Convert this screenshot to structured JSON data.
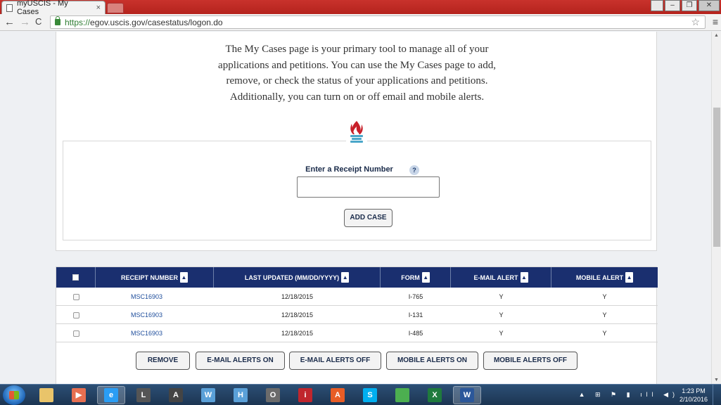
{
  "browser": {
    "tab_title": "myUSCIS - My Cases",
    "tab_close": "×",
    "url_scheme": "https://",
    "url_rest": "egov.uscis.gov/casestatus/logon.do",
    "back_glyph": "←",
    "forward_glyph": "→",
    "reload_glyph": "C",
    "star_glyph": "☆",
    "menu_glyph": "≡",
    "window_buttons": {
      "minimize": "–",
      "restore": "❐",
      "close": "✕"
    }
  },
  "intro": {
    "line1": "The My Cases page is your primary tool to manage all of your",
    "line2": "applications and petitions. You can use the My Cases page to add,",
    "line3": "remove, or check the status of your applications and petitions.",
    "line4": "Additionally, you can turn on or off email and mobile alerts."
  },
  "add_case_form": {
    "label": "Enter a Receipt Number",
    "help": "?",
    "input_value": "",
    "button": "ADD CASE"
  },
  "table": {
    "headers": {
      "receipt": "RECEIPT NUMBER",
      "updated": "LAST UPDATED (MM/DD/YYYY)",
      "form": "FORM",
      "email": "E-MAIL ALERT",
      "mobile": "MOBILE ALERT"
    },
    "rows": [
      {
        "receipt": "MSC16903",
        "updated": "12/18/2015",
        "form": "I-765",
        "email": "Y",
        "mobile": "Y"
      },
      {
        "receipt": "MSC16903",
        "updated": "12/18/2015",
        "form": "I-131",
        "email": "Y",
        "mobile": "Y"
      },
      {
        "receipt": "MSC16903",
        "updated": "12/18/2015",
        "form": "I-485",
        "email": "Y",
        "mobile": "Y"
      }
    ]
  },
  "actions": {
    "remove": "REMOVE",
    "email_on": "E-MAIL ALERTS ON",
    "email_off": "E-MAIL ALERTS OFF",
    "mobile_on": "MOBILE ALERTS ON",
    "mobile_off": "MOBILE ALERTS OFF"
  },
  "taskbar": {
    "apps": [
      {
        "name": "explorer-app",
        "glyph": "",
        "color": "#e9c46a"
      },
      {
        "name": "media-player-app",
        "glyph": "▶",
        "color": "#e76f51"
      },
      {
        "name": "internet-explorer-app",
        "glyph": "e",
        "color": "#2a9df4"
      },
      {
        "name": "l-app",
        "glyph": "L",
        "color": "#555555"
      },
      {
        "name": "a-app",
        "glyph": "A",
        "color": "#444444"
      },
      {
        "name": "w-app",
        "glyph": "W",
        "color": "#5aa0d8"
      },
      {
        "name": "h-app",
        "glyph": "H",
        "color": "#5aa0d8"
      },
      {
        "name": "o-app",
        "glyph": "O",
        "color": "#6b6b6b"
      },
      {
        "name": "i-app",
        "glyph": "i",
        "color": "#c0262d"
      },
      {
        "name": "acrobat-app",
        "glyph": "A",
        "color": "#e85d26"
      },
      {
        "name": "skype-app",
        "glyph": "S",
        "color": "#00aff0"
      },
      {
        "name": "chrome-app",
        "glyph": "",
        "color": "#4caf50"
      },
      {
        "name": "excel-app",
        "glyph": "X",
        "color": "#1f7a3d"
      },
      {
        "name": "word-app",
        "glyph": "W",
        "color": "#2b579a"
      }
    ],
    "tray_icons": "▲ ⊞ ⚑ ▮ ıll ◀)",
    "time": "1:23 PM",
    "date": "2/10/2016"
  }
}
